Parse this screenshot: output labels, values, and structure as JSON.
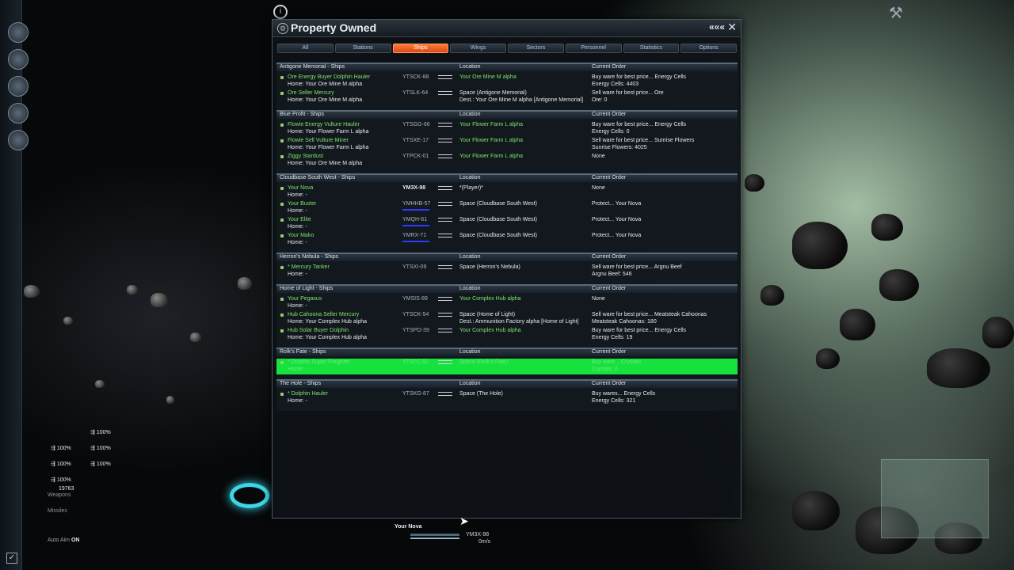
{
  "window": {
    "title": "Property Owned",
    "collapse_label": "«««",
    "close_label": "✕",
    "icon": "gear-icon"
  },
  "tabs": [
    {
      "label": "All",
      "active": false
    },
    {
      "label": "Stations",
      "active": false
    },
    {
      "label": "Ships",
      "active": true
    },
    {
      "label": "Wings",
      "active": false
    },
    {
      "label": "Sectors",
      "active": false
    },
    {
      "label": "Personnel",
      "active": false
    },
    {
      "label": "Statistics",
      "active": false
    },
    {
      "label": "Options",
      "active": false
    }
  ],
  "columns": {
    "location": "Location",
    "order": "Current Order"
  },
  "groups": [
    {
      "name": "Antigone Memorial - Ships",
      "ships": [
        {
          "name": "Ore Energy Buyer Dolphin Hauler",
          "home": "Home: Your Ore Mine M alpha",
          "code": "YTSCK-88",
          "loc1": "Your Ore Mine M alpha",
          "loc1_green": true,
          "loc2": "",
          "ord1": "Buy ware for best price... Energy Cells",
          "ord2": "Energy Cells: 4403"
        },
        {
          "name": "Ore Seller Mercury",
          "home": "Home: Your Ore Mine M alpha",
          "code": "YTSLK-64",
          "loc1": "Space (Antigone Memorial)",
          "loc1_green": false,
          "loc2": "Dest.: Your Ore Mine M alpha [Antigone Memorial]",
          "ord1": "Sell ware for best price... Ore",
          "ord2": "Ore: 0"
        }
      ]
    },
    {
      "name": "Blue Profit - Ships",
      "ships": [
        {
          "name": "Flowie Energy Vulture Hauler",
          "home": "Home: Your Flower Farm L alpha",
          "code": "YTSGG-66",
          "loc1": "Your Flower Farm L alpha",
          "loc1_green": true,
          "loc2": "",
          "ord1": "Buy ware for best price... Energy Cells",
          "ord2": "Energy Cells: 0"
        },
        {
          "name": "Flowie Sell Vulture Miner",
          "home": "Home: Your Flower Farm L alpha",
          "code": "YTSXE-17",
          "loc1": "Your Flower Farm L alpha",
          "loc1_green": true,
          "loc2": "",
          "ord1": "Sell ware for best price... Sunrise Flowers",
          "ord2": "Sunrise Flowers: 4025"
        },
        {
          "name": "Ziggy Stardust",
          "home": "Home: Your Ore Mine M alpha",
          "code": "YTPCK-01",
          "loc1": "Your Flower Farm L alpha",
          "loc1_green": true,
          "loc2": "",
          "ord1": "None",
          "ord2": ""
        }
      ]
    },
    {
      "name": "Cloudbase South West - Ships",
      "ships": [
        {
          "name": "Your Nova",
          "home": "Home: -",
          "code": "YM3X-98",
          "loc1": "*(Player)*",
          "loc1_green": false,
          "loc2": "",
          "ord1": "None",
          "ord2": "",
          "bold_code": true
        },
        {
          "name": "Your Buster",
          "home": "Home: -",
          "code": "YMHHB-57",
          "loc1": "Space (Cloudbase South West)",
          "loc1_green": false,
          "loc2": "",
          "ord1": "Protect... Your Nova",
          "ord2": "",
          "bar": true
        },
        {
          "name": "Your Elite",
          "home": "Home: -",
          "code": "YMQH-61",
          "loc1": "Space (Cloudbase South West)",
          "loc1_green": false,
          "loc2": "",
          "ord1": "Protect... Your Nova",
          "ord2": "",
          "bar": true
        },
        {
          "name": "Your Mako",
          "home": "Home: -",
          "code": "YMRX-71",
          "loc1": "Space (Cloudbase South West)",
          "loc1_green": false,
          "loc2": "",
          "ord1": "Protect... Your Nova",
          "ord2": "",
          "bar": true
        }
      ]
    },
    {
      "name": "Herron's Nebula - Ships",
      "ships": [
        {
          "name": "* Mercury Tanker",
          "home": "Home: -",
          "code": "YTSXI-09",
          "loc1": "Space (Herron's Nebula)",
          "loc1_green": false,
          "loc2": "",
          "ord1": "Sell ware for best price... Argnu Beef",
          "ord2": "Argnu Beef: 546"
        }
      ]
    },
    {
      "name": "Home of Light - Ships",
      "ships": [
        {
          "name": "Your Pegasus",
          "home": "Home: -",
          "code": "YMSIS-89",
          "loc1": "Your Complex Hub alpha",
          "loc1_green": true,
          "loc2": "",
          "ord1": "None",
          "ord2": ""
        },
        {
          "name": "Hub Cahoona Seller Mercury",
          "home": "Home: Your Complex Hub alpha",
          "code": "YTSCK-54",
          "loc1": "Space (Home of Light)",
          "loc1_green": false,
          "loc2": "Dest.: Ammunition Factory alpha [Home of Light]",
          "ord1": "Sell ware for best price... Meatsteak Cahoonas",
          "ord2": "Meatsteak Cahoonas: 180"
        },
        {
          "name": "Hub Solar Buyer Dolphin",
          "home": "Home: Your Complex Hub alpha",
          "code": "YTSPO-39",
          "loc1": "Your Complex Hub alpha",
          "loc1_green": true,
          "loc2": "",
          "ord1": "Buy ware for best price... Energy Cells",
          "ord2": "Energy Cells: 19"
        }
      ]
    },
    {
      "name": "Rolk's Fate - Ships",
      "ships": [
        {
          "name": "* Dolphin Super Freighter",
          "home": "Home: -",
          "code": "YTSTC-92",
          "loc1": "Space (Rolk's Fate)",
          "loc1_green": false,
          "loc2": "",
          "ord1": "Buy ware... Crystals",
          "ord2": "Crystals: 0",
          "selected": true
        }
      ]
    },
    {
      "name": "The Hole - Ships",
      "ships": [
        {
          "name": "* Dolphin Hauler",
          "home": "Home: -",
          "code": "YTSKG-87",
          "loc1": "Space (The Hole)",
          "loc1_green": false,
          "loc2": "",
          "ord1": "Buy wares... Energy Cells",
          "ord2": "Energy Cells: 321"
        }
      ]
    }
  ],
  "hud": {
    "weapons": [
      "100%",
      "100%",
      "100%",
      "100%",
      "100%",
      "100%"
    ],
    "ammo": "19763",
    "weapons_label": "Weapons",
    "missiles_label": "Missiles",
    "auto_aim_label": "Auto Aim",
    "auto_aim_state": "ON",
    "ship_name": "Your Nova",
    "ship_code": "YM3X-98",
    "speed": "0m/s",
    "shield_level": 1.0,
    "hull_level": 1.0
  }
}
